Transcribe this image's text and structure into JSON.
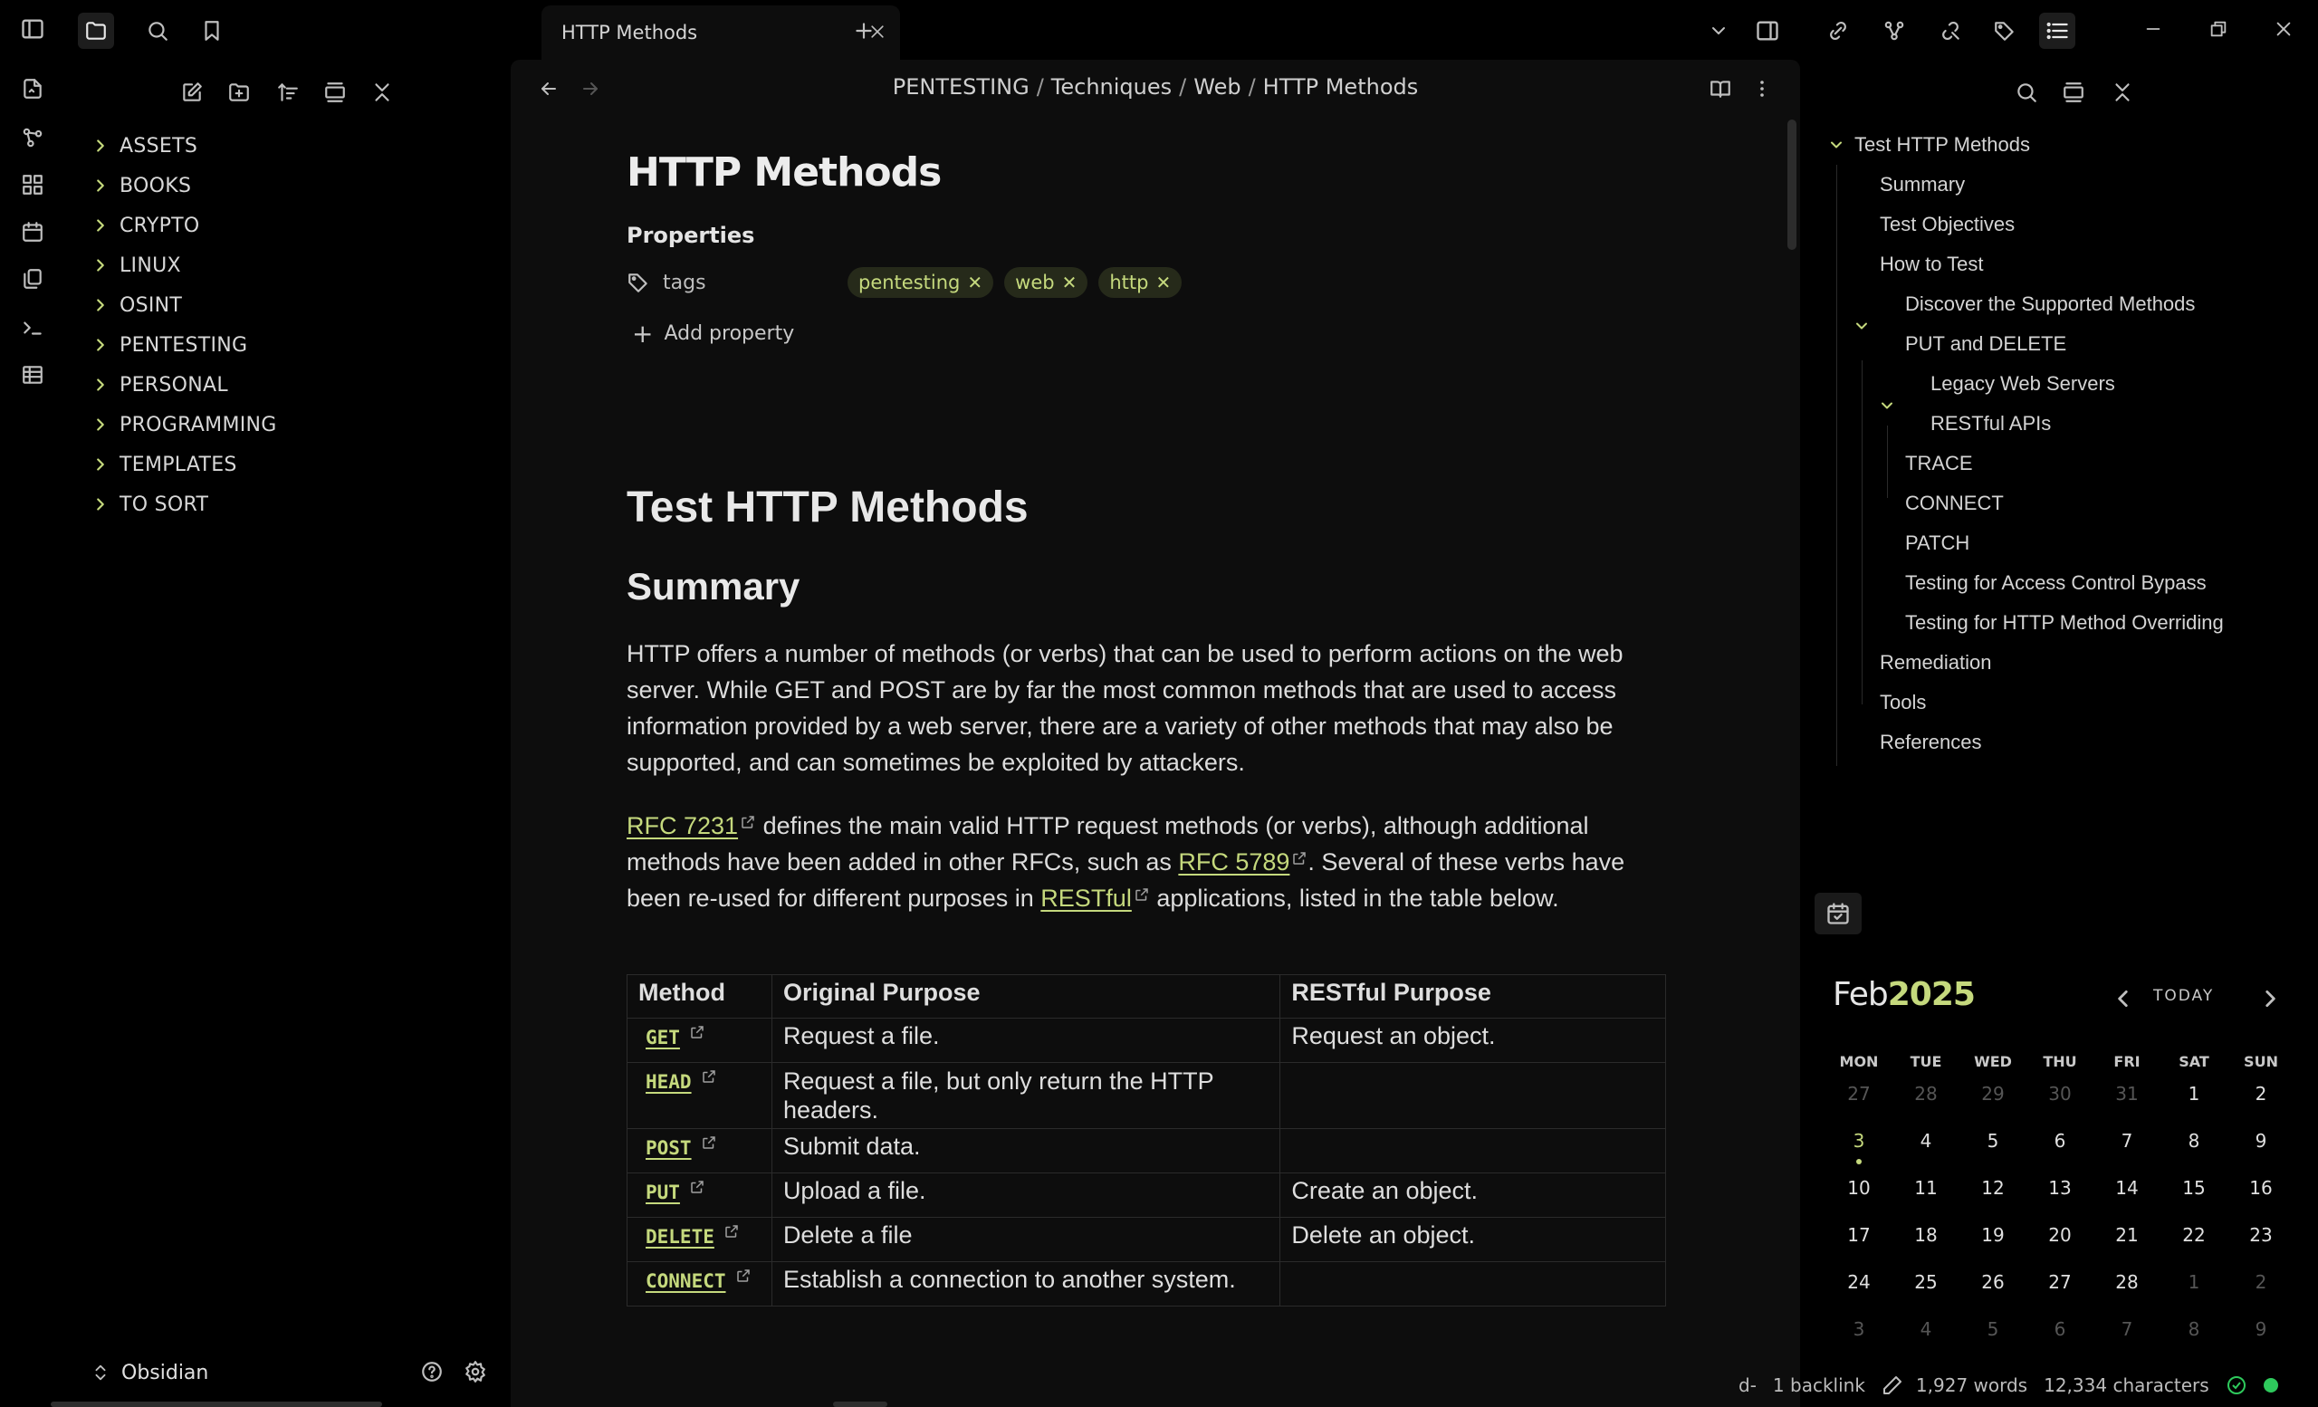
{
  "tab": {
    "title": "HTTP Methods"
  },
  "breadcrumb": [
    "PENTESTING",
    "Techniques",
    "Web",
    "HTTP Methods"
  ],
  "file_tree": {
    "folders": [
      "ASSETS",
      "BOOKS",
      "CRYPTO",
      "LINUX",
      "OSINT",
      "PENTESTING",
      "PERSONAL",
      "PROGRAMMING",
      "TEMPLATES",
      "TO SORT"
    ]
  },
  "vault": {
    "name": "Obsidian"
  },
  "note": {
    "title": "HTTP Methods",
    "properties_heading": "Properties",
    "property_key": "tags",
    "tags": [
      "pentesting",
      "web",
      "http"
    ],
    "add_property": "Add property",
    "h1": "Test HTTP Methods",
    "h2_summary": "Summary",
    "para1": "HTTP offers a number of methods (or verbs) that can be used to perform actions on the web server. While GET and POST are by far the most common methods that are used to access information provided by a web server, there are a variety of other methods that may also be supported, and can sometimes be exploited by attackers.",
    "para2": {
      "link1": "RFC 7231",
      "text1": " defines the main valid HTTP request methods (or verbs), although additional methods have been added in other RFCs, such as ",
      "link2": "RFC 5789",
      "text2": ". Several of these verbs have been re-used for different purposes in ",
      "link3": "RESTful",
      "text3": " applications, listed in the table below."
    },
    "table": {
      "headers": [
        "Method",
        "Original Purpose",
        "RESTful Purpose"
      ],
      "rows": [
        {
          "method": "GET",
          "original": "Request a file.",
          "restful": "Request an object."
        },
        {
          "method": "HEAD",
          "original": "Request a file, but only return the HTTP headers.",
          "restful": ""
        },
        {
          "method": "POST",
          "original": "Submit data.",
          "restful": ""
        },
        {
          "method": "PUT",
          "original": "Upload a file.",
          "restful": "Create an object."
        },
        {
          "method": "DELETE",
          "original": "Delete a file",
          "restful": "Delete an object."
        },
        {
          "method": "CONNECT",
          "original": "Establish a connection to another system.",
          "restful": ""
        }
      ]
    }
  },
  "outline": {
    "items": [
      {
        "label": "Test HTTP Methods",
        "level": 0,
        "collapsible": true
      },
      {
        "label": "Summary",
        "level": 1
      },
      {
        "label": "Test Objectives",
        "level": 1
      },
      {
        "label": "How to Test",
        "level": 1,
        "collapsible": true
      },
      {
        "label": "Discover the Supported Methods",
        "level": 2
      },
      {
        "label": "PUT and DELETE",
        "level": 2,
        "collapsible": true
      },
      {
        "label": "Legacy Web Servers",
        "level": 3
      },
      {
        "label": "RESTful APIs",
        "level": 3
      },
      {
        "label": "TRACE",
        "level": 2
      },
      {
        "label": "CONNECT",
        "level": 2
      },
      {
        "label": "PATCH",
        "level": 2
      },
      {
        "label": "Testing for Access Control Bypass",
        "level": 2
      },
      {
        "label": "Testing for HTTP Method Overriding",
        "level": 2
      },
      {
        "label": "Remediation",
        "level": 1
      },
      {
        "label": "Tools",
        "level": 1
      },
      {
        "label": "References",
        "level": 1
      }
    ]
  },
  "calendar": {
    "month": "Feb",
    "year": "2025",
    "today_label": "TODAY",
    "weekdays": [
      "MON",
      "TUE",
      "WED",
      "THU",
      "FRI",
      "SAT",
      "SUN"
    ],
    "weeks": [
      [
        "27",
        "28",
        "29",
        "30",
        "31",
        "1",
        "2"
      ],
      [
        "3",
        "4",
        "5",
        "6",
        "7",
        "8",
        "9"
      ],
      [
        "10",
        "11",
        "12",
        "13",
        "14",
        "15",
        "16"
      ],
      [
        "17",
        "18",
        "19",
        "20",
        "21",
        "22",
        "23"
      ],
      [
        "24",
        "25",
        "26",
        "27",
        "28",
        "1",
        "2"
      ],
      [
        "3",
        "4",
        "5",
        "6",
        "7",
        "8",
        "9"
      ]
    ],
    "today": "3",
    "accent_color": "#c5d97d"
  },
  "status": {
    "mode": "d-",
    "backlinks": "1 backlink",
    "words": "1,927 words",
    "characters": "12,334 characters",
    "sync_color": "#2ec95c"
  }
}
